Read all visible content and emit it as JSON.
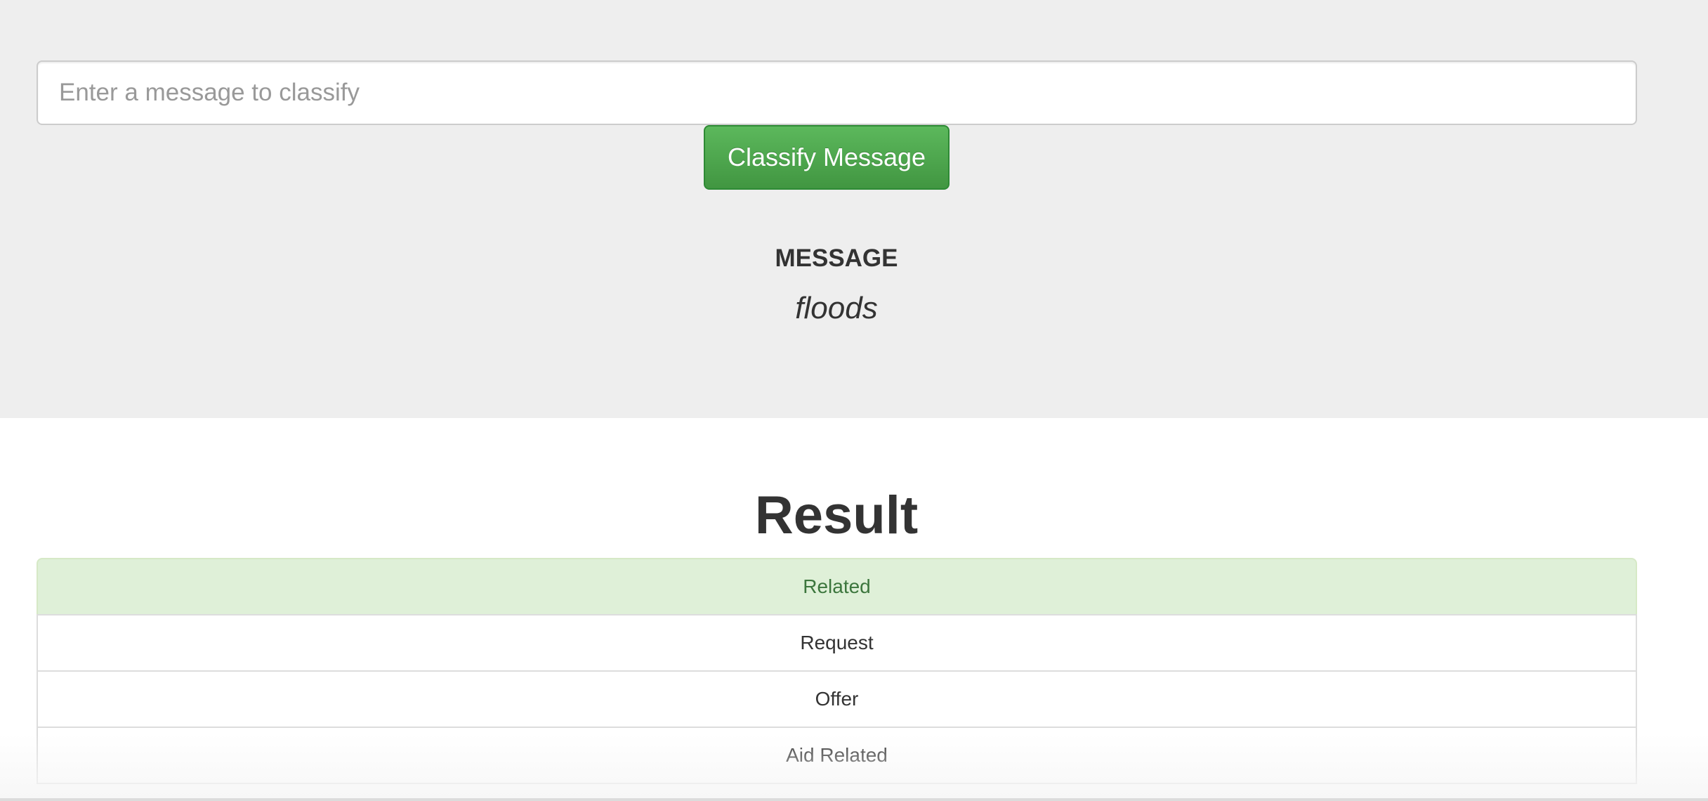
{
  "classifier": {
    "input_placeholder": "Enter a message to classify",
    "input_value": "",
    "button_label": "Classify Message",
    "button_color": "#5cb85c"
  },
  "message": {
    "heading": "MESSAGE",
    "text": "floods"
  },
  "result": {
    "title": "Result",
    "categories": [
      {
        "label": "Related",
        "positive": true
      },
      {
        "label": "Request",
        "positive": false
      },
      {
        "label": "Offer",
        "positive": false
      },
      {
        "label": "Aid Related",
        "positive": false
      }
    ],
    "positive_bg_color": "#dff0d8",
    "positive_text_color": "#3c763d"
  }
}
